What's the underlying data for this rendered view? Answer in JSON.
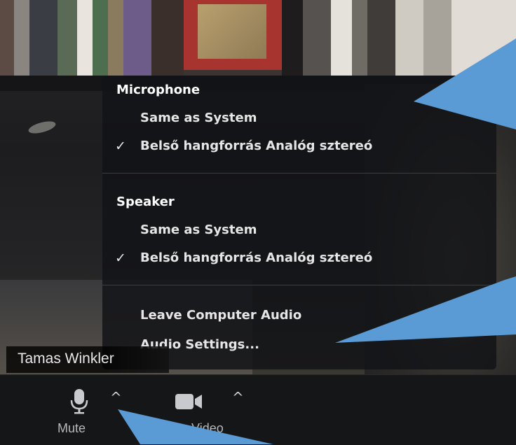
{
  "participant": {
    "name": "Tamas Winkler"
  },
  "audio_menu": {
    "microphone_header": "Microphone",
    "microphone_options": [
      {
        "label": "Same as System",
        "checked": false
      },
      {
        "label": "Belső hangforrás Analóg sztereó",
        "checked": true
      }
    ],
    "speaker_header": "Speaker",
    "speaker_options": [
      {
        "label": "Same as System",
        "checked": false
      },
      {
        "label": "Belső hangforrás Analóg sztereó",
        "checked": true
      }
    ],
    "actions": [
      {
        "label": "Leave Computer Audio"
      },
      {
        "label": "Audio Settings..."
      }
    ],
    "check_glyph": "✓"
  },
  "toolbar": {
    "mute_label": "Mute",
    "video_label": "Stop Video",
    "video_label_visible": "p Video",
    "chevron_glyph": "^",
    "mute_icon": "microphone-icon",
    "video_icon": "video-camera-icon"
  },
  "colors": {
    "callout": "#5b9bd5",
    "menu_bg": "#121317",
    "toolbar_bg": "#151618"
  }
}
